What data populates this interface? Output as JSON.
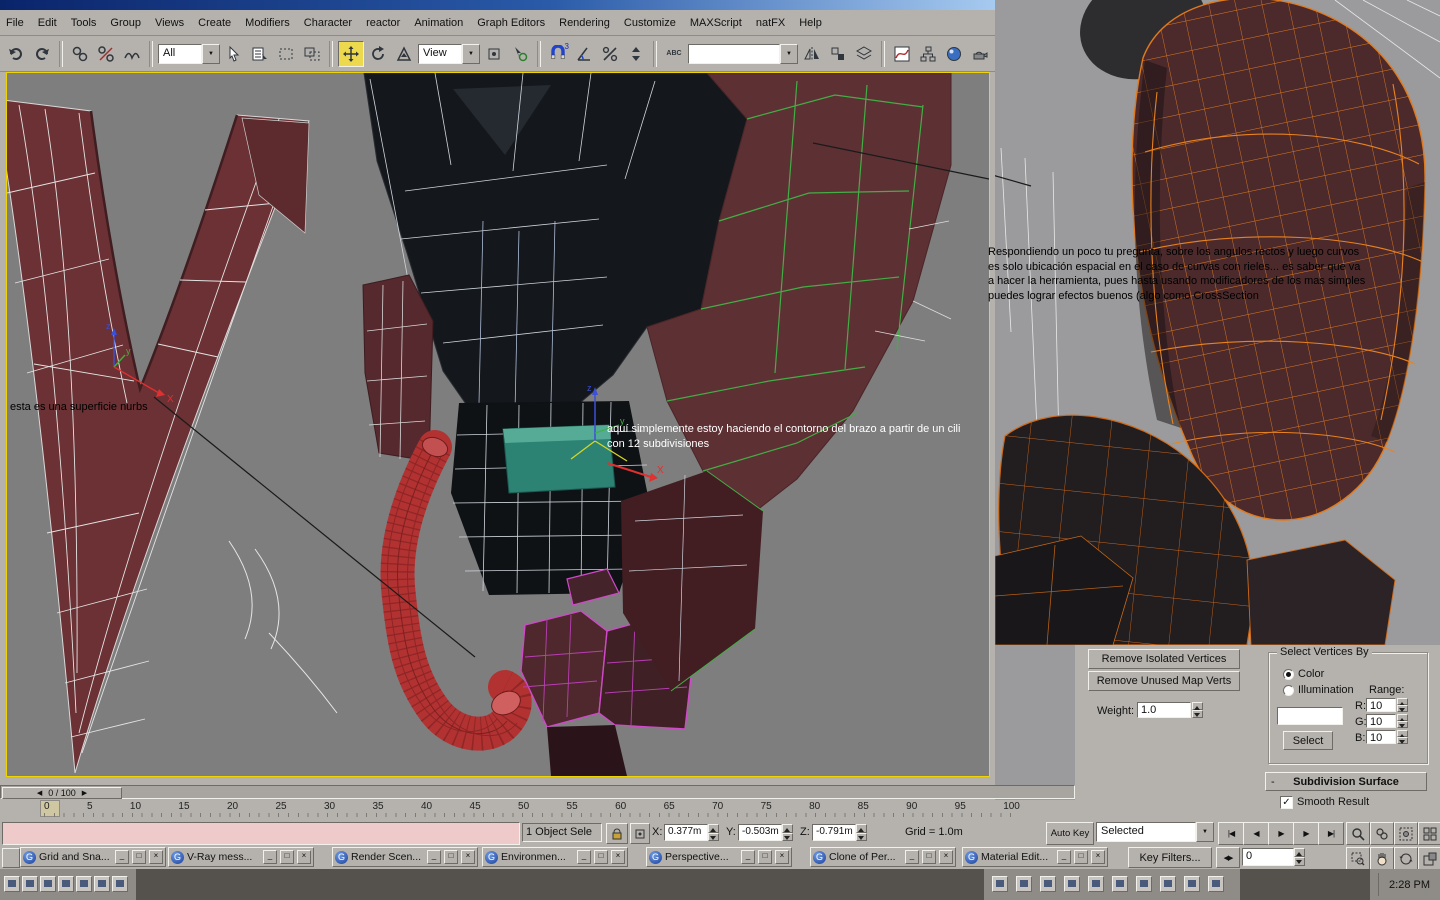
{
  "menu": {
    "items": [
      "File",
      "Edit",
      "Tools",
      "Group",
      "Views",
      "Create",
      "Modifiers",
      "Character",
      "reactor",
      "Animation",
      "Graph Editors",
      "Rendering",
      "Customize",
      "MAXScript",
      "natFX",
      "Help"
    ]
  },
  "toolbar": {
    "selection_filter": "All",
    "coord_system": "View",
    "snap_value": "3",
    "abc": "ABC",
    "named_selection": ""
  },
  "icons": {
    "dropdown": "▼",
    "minimize": "_",
    "restore": "□",
    "close": "×",
    "check": "✓",
    "dash": "-",
    "g": "G",
    "go_start": "|◀",
    "prev_frame": "◀",
    "play": "▶",
    "next_frame": "▶",
    "go_end": "▶|",
    "key_toggle": "◀▶"
  },
  "viewport": {
    "axis": {
      "x": "X",
      "y": "y",
      "z": "z"
    },
    "annotations": {
      "nurbs": "esta es una superficie nurbs",
      "cylinder_line1": "aquí simplemente estoy haciendo el contorno del brazo a partir de un cili",
      "cylinder_line2": "con 12 subdivisiones",
      "reply": [
        "Respondiendo un poco tu pregunta, sobre los angulos rectos y luego curvos",
        "es solo ubicación espacial en el caso de curvas con rieles... es saber que va",
        "a hacer la herramienta, pues hasta usando modificadores de los mas simples",
        "puedes lograr efectos buenos (algo como CrossSection"
      ]
    }
  },
  "panel": {
    "remove_isolated": "Remove Isolated Vertices",
    "remove_unused": "Remove Unused Map Verts",
    "weight_label": "Weight:",
    "weight_value": "1.0",
    "group_title": "Select Vertices By",
    "color_label": "Color",
    "illumination_label": "Illumination",
    "range_label": "Range:",
    "rgb": {
      "r_label": "R:",
      "g_label": "G:",
      "b_label": "B:",
      "r": "10",
      "g": "10",
      "b": "10"
    },
    "select_button": "Select",
    "rollout_title": "Subdivision Surface",
    "smooth_result": "Smooth Result"
  },
  "timeline": {
    "slider_label": "0 / 100",
    "ticks": [
      "0",
      "5",
      "10",
      "15",
      "20",
      "25",
      "30",
      "35",
      "40",
      "45",
      "50",
      "55",
      "60",
      "65",
      "70",
      "75",
      "80",
      "85",
      "90",
      "95",
      "100"
    ]
  },
  "status": {
    "selection": "1 Object Sele",
    "x_label": "X:",
    "x": "0.377m",
    "y_label": "Y:",
    "y": "-0.503m",
    "z_label": "Z:",
    "z": "-0.791m",
    "grid": "Grid = 1.0m"
  },
  "time": {
    "auto_key": "Auto Key",
    "key_mode": "Selected",
    "key_filters": "Key Filters...",
    "frame": "0"
  },
  "taskbar": {
    "windows": [
      "Grid and Sna...",
      "V-Ray mess...",
      "Render Scen...",
      "Environmen...",
      "Perspective...",
      "Clone of Per...",
      "Material Edit..."
    ],
    "clock": "2:28 PM"
  }
}
